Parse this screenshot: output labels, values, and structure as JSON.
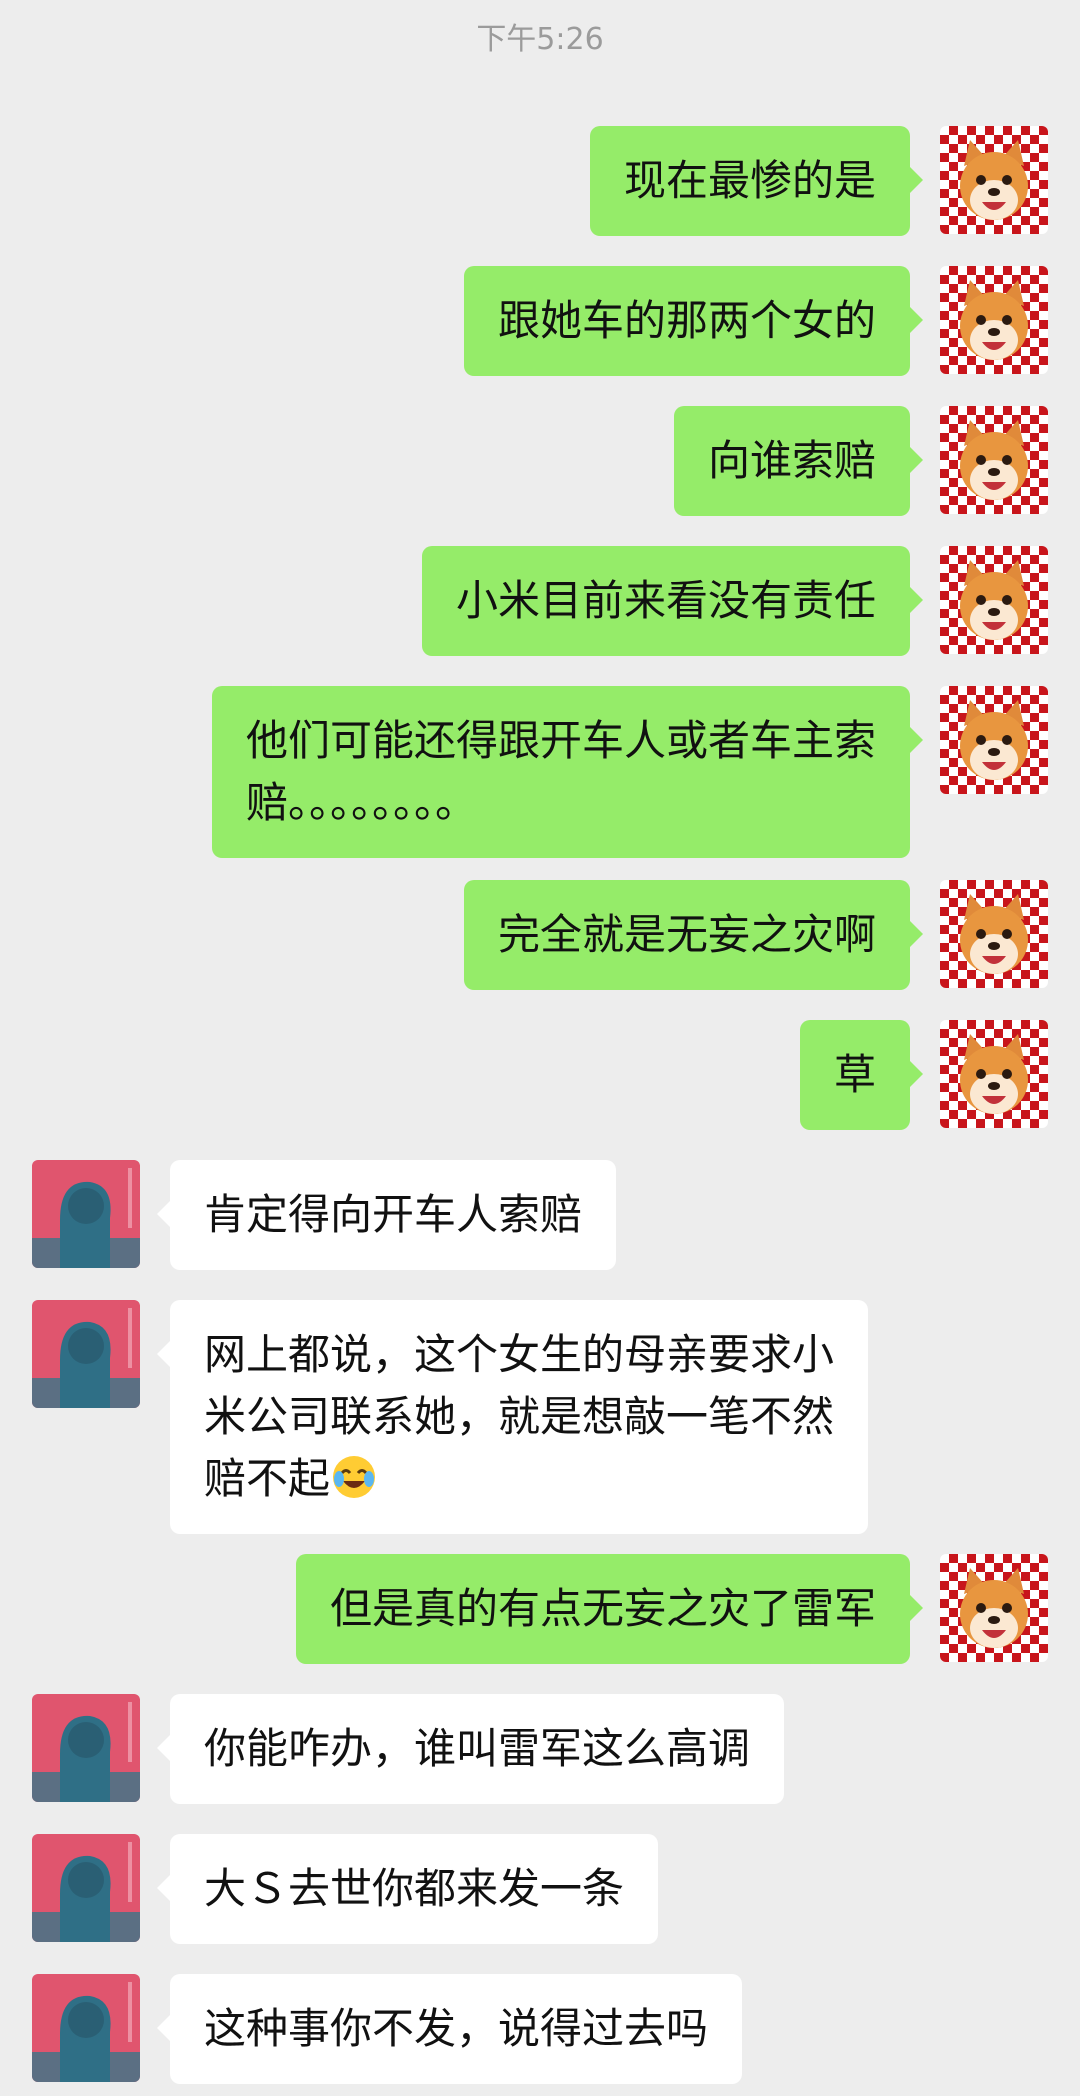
{
  "timestamp": "下午5:26",
  "messages": [
    {
      "side": "right",
      "text": "现在最惨的是"
    },
    {
      "side": "right",
      "text": "跟她车的那两个女的"
    },
    {
      "side": "right",
      "text": "向谁索赔"
    },
    {
      "side": "right",
      "text": "小米目前来看没有责任"
    },
    {
      "side": "right",
      "text": "他们可能还得跟开车人或者车主索赔。。。。。。。。"
    },
    {
      "side": "right",
      "text": "完全就是无妄之灾啊"
    },
    {
      "side": "right",
      "text": "草"
    },
    {
      "side": "left",
      "text": "肯定得向开车人索赔"
    },
    {
      "side": "left",
      "text": "网上都说，这个女生的母亲要求小米公司联系她，就是想敲一笔不然赔不起",
      "emoji": "crying-laughing-emoji"
    },
    {
      "side": "right",
      "text": "但是真的有点无妄之灾了雷军"
    },
    {
      "side": "left",
      "text": "你能咋办，谁叫雷军这么高调"
    },
    {
      "side": "left",
      "text": "大Ｓ去世你都来发一条"
    },
    {
      "side": "left",
      "text": "这种事你不发，说得过去吗"
    }
  ],
  "wrapped_lines": {
    "msg5": [
      "他们可能还得跟开车人或者车主索",
      "赔。。。。。。。。"
    ],
    "msg9": [
      "网上都说，这个女生的母亲要求小",
      "米公司联系她，就是想敲一笔不然",
      "赔不起"
    ]
  },
  "colors": {
    "background": "#ededed",
    "outgoing_bubble": "#95ec69",
    "incoming_bubble": "#ffffff",
    "timestamp_text": "#9b9b9b"
  },
  "icons": {
    "self_avatar": "shiba-dog-avatar",
    "peer_avatar": "girl-silhouette-avatar"
  }
}
